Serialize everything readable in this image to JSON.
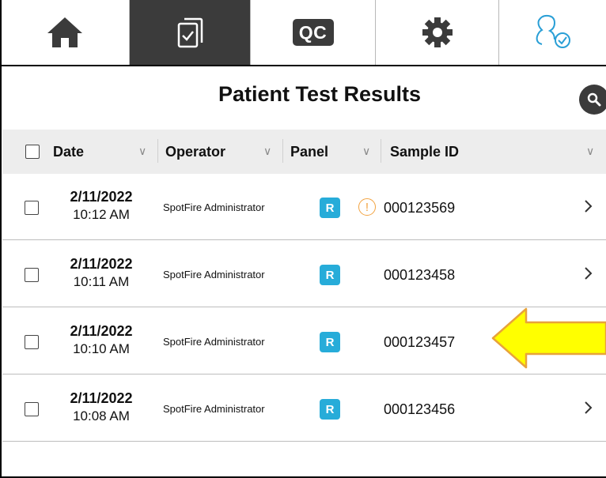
{
  "nav": {
    "tabs": [
      {
        "name": "home",
        "icon": "home-icon"
      },
      {
        "name": "results",
        "icon": "clipboard-check-icon",
        "active": true
      },
      {
        "name": "qc",
        "label": "QC"
      },
      {
        "name": "settings",
        "icon": "gear-icon"
      },
      {
        "name": "user",
        "icon": "user-check-icon"
      }
    ]
  },
  "page": {
    "title": "Patient Test Results"
  },
  "table": {
    "headers": {
      "date": "Date",
      "operator": "Operator",
      "panel": "Panel",
      "sample_id": "Sample ID"
    },
    "rows": [
      {
        "date": "2/11/2022",
        "time": "10:12 AM",
        "operator": "SpotFire Administrator",
        "panel": "R",
        "warning": "!",
        "sample_id": "000123569",
        "arrow": true
      },
      {
        "date": "2/11/2022",
        "time": "10:11 AM",
        "operator": "SpotFire Administrator",
        "panel": "R",
        "sample_id": "000123458",
        "arrow": true
      },
      {
        "date": "2/11/2022",
        "time": "10:10 AM",
        "operator": "SpotFire Administrator",
        "panel": "R",
        "sample_id": "000123457",
        "arrow": false
      },
      {
        "date": "2/11/2022",
        "time": "10:08 AM",
        "operator": "SpotFire Administrator",
        "panel": "R",
        "sample_id": "000123456",
        "arrow": true
      }
    ]
  },
  "colors": {
    "nav_active": "#3b3b3b",
    "panel_badge": "#27acd9",
    "warning": "#f2a341",
    "highlight_arrow": "#ffff00",
    "user_icon": "#2a9fd6"
  }
}
